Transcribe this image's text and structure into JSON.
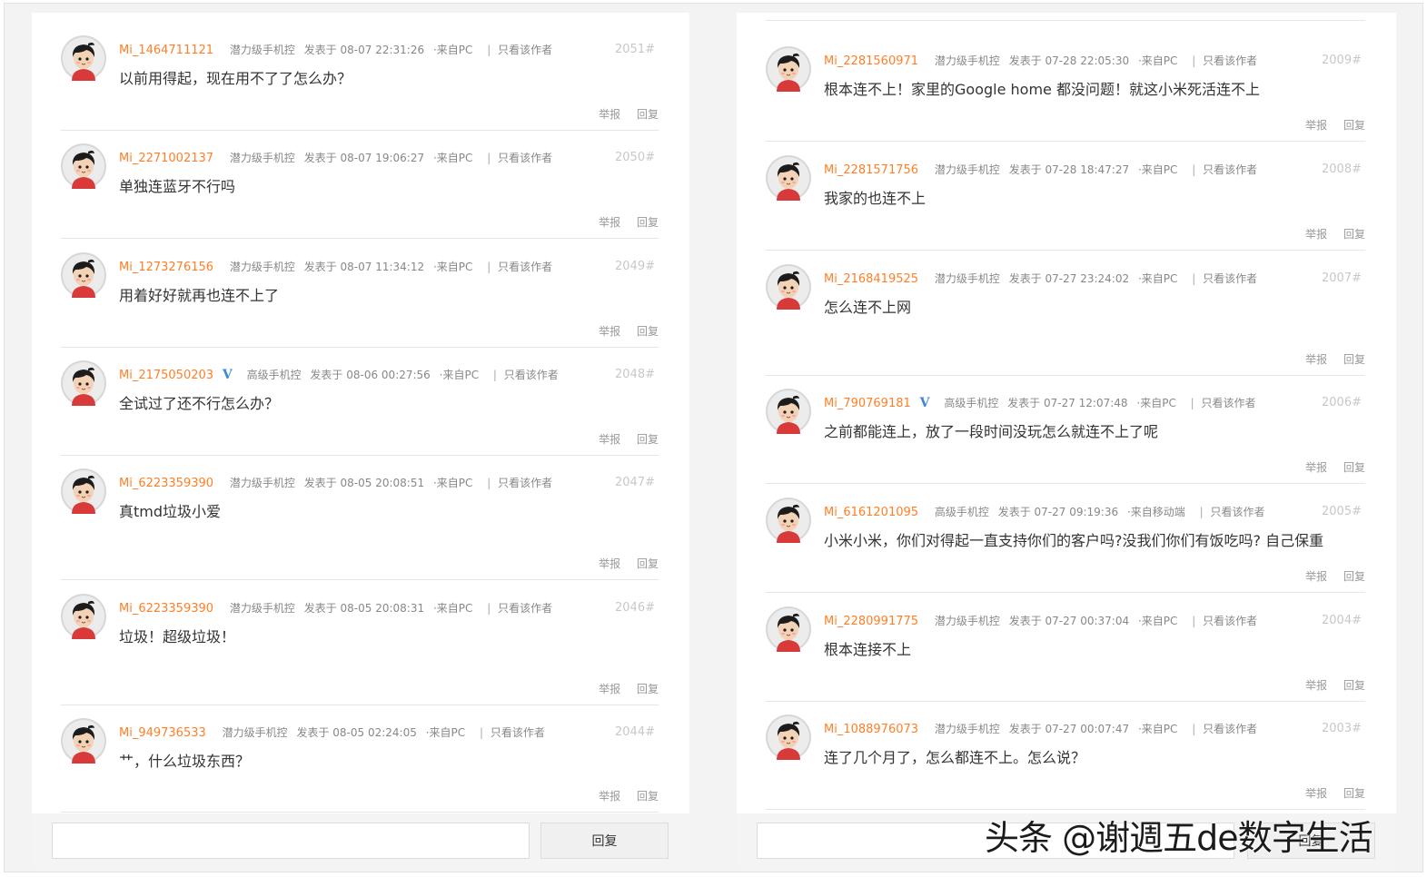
{
  "left_posts": [
    {
      "user": "Mi_1464711121",
      "verified": false,
      "level": "潜力级手机控",
      "posted": "发表于 08-07 22:31:26",
      "source": "·来自PC",
      "filter": "只看该作者",
      "floor": "2051#",
      "content": "以前用得起，现在用不了了怎么办？",
      "report": "举报",
      "reply": "回复"
    },
    {
      "user": "Mi_2271002137",
      "verified": false,
      "level": "潜力级手机控",
      "posted": "发表于 08-07 19:06:27",
      "source": "·来自PC",
      "filter": "只看该作者",
      "floor": "2050#",
      "content": "单独连蓝牙不行吗",
      "report": "举报",
      "reply": "回复"
    },
    {
      "user": "Mi_1273276156",
      "verified": false,
      "level": "潜力级手机控",
      "posted": "发表于 08-07 11:34:12",
      "source": "·来自PC",
      "filter": "只看该作者",
      "floor": "2049#",
      "content": "用着好好就再也连不上了",
      "report": "举报",
      "reply": "回复"
    },
    {
      "user": "Mi_2175050203",
      "verified": true,
      "level": "高级手机控",
      "posted": "发表于 08-06 00:27:56",
      "source": "·来自PC",
      "filter": "只看该作者",
      "floor": "2048#",
      "content": "全试过了还不行怎么办？",
      "report": "举报",
      "reply": "回复"
    },
    {
      "user": "Mi_6223359390",
      "verified": false,
      "level": "潜力级手机控",
      "posted": "发表于 08-05 20:08:51",
      "source": "·来自PC",
      "filter": "只看该作者",
      "floor": "2047#",
      "content": "真tmd垃圾小爱",
      "report": "举报",
      "reply": "回复"
    },
    {
      "user": "Mi_6223359390",
      "verified": false,
      "level": "潜力级手机控",
      "posted": "发表于 08-05 20:08:31",
      "source": "·来自PC",
      "filter": "只看该作者",
      "floor": "2046#",
      "content": "垃圾！超级垃圾！",
      "report": "举报",
      "reply": "回复"
    },
    {
      "user": "Mi_949736533",
      "verified": false,
      "level": "潜力级手机控",
      "posted": "发表于 08-05 02:24:05",
      "source": "·来自PC",
      "filter": "只看该作者",
      "floor": "2044#",
      "content": "艹，什么垃圾东西？",
      "report": "举报",
      "reply": "回复"
    }
  ],
  "right_posts": [
    {
      "user": "Mi_2281560971",
      "verified": false,
      "level": "潜力级手机控",
      "posted": "发表于 07-28 22:05:30",
      "source": "·来自PC",
      "filter": "只看该作者",
      "floor": "2009#",
      "content": "根本连不上！家里的Google home 都没问题！就这小米死活连不上",
      "report": "举报",
      "reply": "回复"
    },
    {
      "user": "Mi_2281571756",
      "verified": false,
      "level": "潜力级手机控",
      "posted": "发表于 07-28 18:47:27",
      "source": "·来自PC",
      "filter": "只看该作者",
      "floor": "2008#",
      "content": "我家的也连不上",
      "report": "举报",
      "reply": "回复"
    },
    {
      "user": "Mi_2168419525",
      "verified": false,
      "level": "潜力级手机控",
      "posted": "发表于 07-27 23:24:02",
      "source": "·来自PC",
      "filter": "只看该作者",
      "floor": "2007#",
      "content": "怎么连不上网",
      "report": "举报",
      "reply": "回复"
    },
    {
      "user": "Mi_790769181",
      "verified": true,
      "level": "高级手机控",
      "posted": "发表于 07-27 12:07:48",
      "source": "·来自PC",
      "filter": "只看该作者",
      "floor": "2006#",
      "content": "之前都能连上，放了一段时间没玩怎么就连不上了呢",
      "report": "举报",
      "reply": "回复"
    },
    {
      "user": "Mi_6161201095",
      "verified": false,
      "level": "高级手机控",
      "posted": "发表于 07-27 09:19:36",
      "source": "·来自移动端",
      "filter": "只看该作者",
      "floor": "2005#",
      "content": "小米小米，你们对得起一直支持你们的客户吗?没我们你们有饭吃吗? 自己保重",
      "report": "举报",
      "reply": "回复"
    },
    {
      "user": "Mi_2280991775",
      "verified": false,
      "level": "潜力级手机控",
      "posted": "发表于 07-27 00:37:04",
      "source": "·来自PC",
      "filter": "只看该作者",
      "floor": "2004#",
      "content": "根本连接不上",
      "report": "举报",
      "reply": "回复"
    },
    {
      "user": "Mi_1088976073",
      "verified": false,
      "level": "潜力级手机控",
      "posted": "发表于 07-27 00:07:47",
      "source": "·来自PC",
      "filter": "只看该作者",
      "floor": "2003#",
      "content": "连了几个月了，怎么都连不上。怎么说？",
      "report": "举报",
      "reply": "回复"
    }
  ],
  "reply_bar": {
    "button_label": "回复",
    "input_value": ""
  },
  "verified_badge": "V",
  "watermark": "头条 @谢週五de数字生活",
  "colors": {
    "username": "#ff7f27",
    "verified": "#3c88d8",
    "floor": "#c8c8c8"
  }
}
